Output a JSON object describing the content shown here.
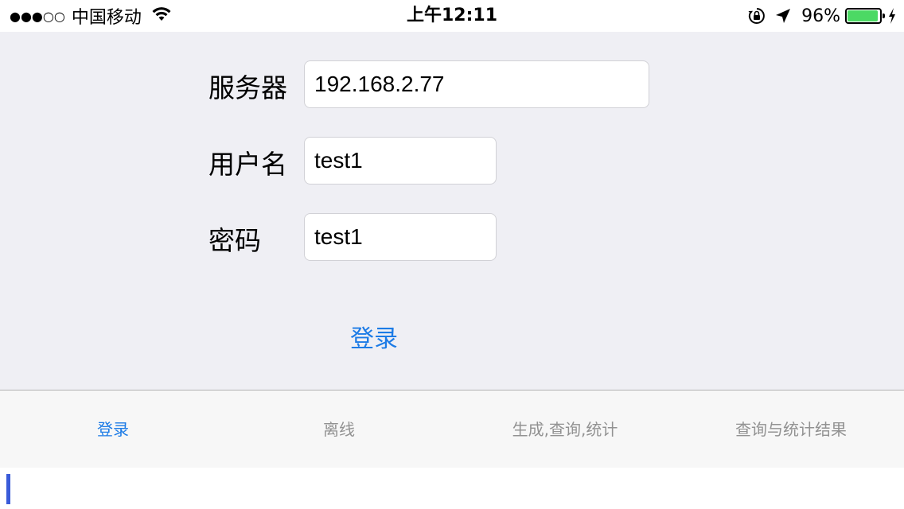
{
  "status_bar": {
    "signal": "●●●○○",
    "carrier": "中国移动",
    "time": "上午12:11",
    "battery_percent": "96%",
    "battery_level": 0.96,
    "icons": [
      "wifi-icon",
      "rotation-lock-icon",
      "location-arrow-icon",
      "battery-icon",
      "charging-bolt-icon"
    ]
  },
  "form": {
    "server_label": "服务器",
    "server_value": "192.168.2.77",
    "username_label": "用户名",
    "username_value": "test1",
    "password_label": "密码",
    "password_value": "test1",
    "login_label": "登录"
  },
  "tabs": [
    {
      "label": "登录",
      "active": true
    },
    {
      "label": "离线",
      "active": false
    },
    {
      "label": "生成,查询,统计",
      "active": false
    },
    {
      "label": "查询与统计结果",
      "active": false
    }
  ],
  "colors": {
    "accent": "#1c7be6",
    "background": "#efeff4",
    "tab_bar": "#f7f7f7",
    "battery": "#4cd964",
    "inactive_tab": "#929292"
  }
}
